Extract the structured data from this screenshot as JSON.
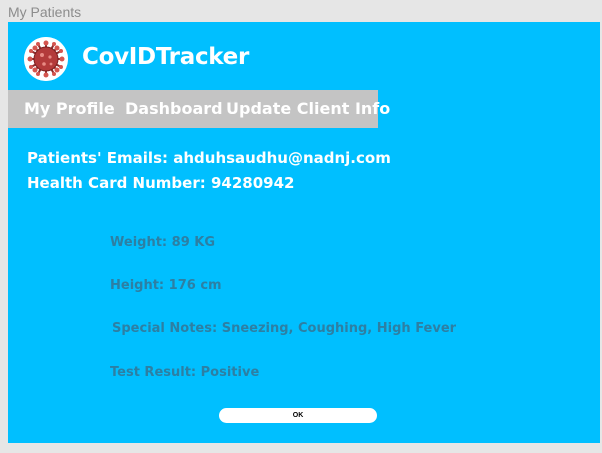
{
  "window": {
    "title": "My Patients"
  },
  "header": {
    "app_title": "CovIDTracker",
    "logo_icon": "virus-icon"
  },
  "nav": {
    "items": [
      {
        "label": "My Profile"
      },
      {
        "label": "Dashboard"
      },
      {
        "label": "Update Client Info"
      }
    ]
  },
  "patient": {
    "emails_label": "Patients' Emails:",
    "emails_value": "ahduhsaudhu@nadnj.com",
    "health_card_label": "Health Card Number:",
    "health_card_value": "94280942",
    "weight": "Weight: 89 KG",
    "height": "Height: 176 cm",
    "special_notes": "Special Notes: Sneezing, Coughing, High Fever",
    "test_result": "Test Result: Positive"
  },
  "actions": {
    "ok_label": "OK"
  },
  "colors": {
    "background": "#00bfff",
    "nav_bar": "#c4c4c4",
    "detail_text": "#2d7fa3",
    "virus": "#b33a3a"
  }
}
